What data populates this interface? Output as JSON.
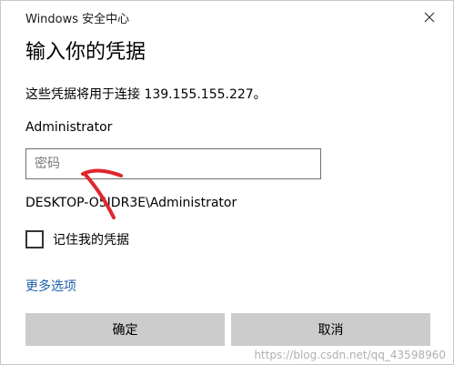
{
  "window": {
    "title": "Windows 安全中心",
    "close_icon": "close-icon"
  },
  "dialog": {
    "heading": "输入你的凭据",
    "info": "这些凭据将用于连接 139.155.155.227。",
    "username": "Administrator",
    "password": {
      "value": "",
      "placeholder": "密码"
    },
    "domain_user": "DESKTOP-O5IDR3E\\Administrator",
    "remember": {
      "label": "记住我的凭据",
      "checked": false
    },
    "more_options": "更多选项",
    "buttons": {
      "ok": "确定",
      "cancel": "取消"
    }
  },
  "annotation": {
    "icon": "red-arrow-icon",
    "color": "#e0262d"
  },
  "watermark": "https://blog.csdn.net/qq_43598960",
  "colors": {
    "link": "#1f5fa8",
    "button_bg": "#cccccc",
    "input_border": "#6f6f6f"
  }
}
